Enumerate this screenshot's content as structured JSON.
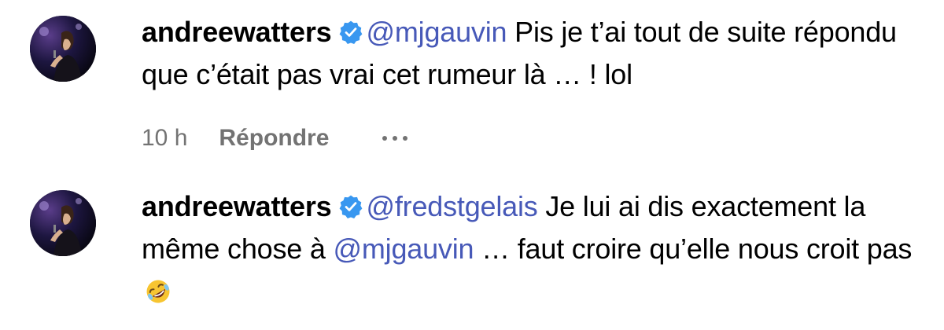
{
  "comments": [
    {
      "username": "andreewatters",
      "verified": true,
      "mention": "@mjgauvin",
      "text": " Pis je t’ai tout de suite répondu que c’était pas vrai cet rumeur là … ! lol",
      "timestamp": "10 h",
      "reply_label": "Répondre",
      "more_label": "•••"
    },
    {
      "username": "andreewatters",
      "verified": true,
      "mention": "@fredstgelais",
      "text_before_mention2": " Je lui ai dis exactement la même chose à ",
      "mention2": "@mjgauvin",
      "text_after": " … faut croire qu’elle nous croit pas",
      "emoji": "rolling-on-floor-laughing"
    }
  ],
  "colors": {
    "mention": "#4759b8",
    "meta_text": "#737373",
    "verified_badge": "#3897f0"
  }
}
